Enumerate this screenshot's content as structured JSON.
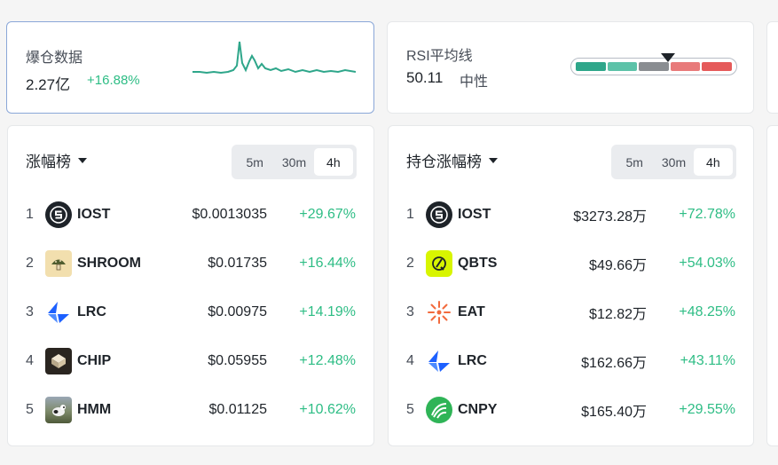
{
  "liquidation": {
    "title": "爆仓数据",
    "value": "2.27亿",
    "change": "+16.88%"
  },
  "rsi": {
    "title": "RSI平均线",
    "value": "50.11",
    "status": "中性",
    "segment_colors": [
      "#2ea68a",
      "#5cc2a8",
      "#8a8d91",
      "#e87a7a",
      "#e55a5a"
    ]
  },
  "gainers": {
    "title": "涨幅榜",
    "intervals": [
      "5m",
      "30m",
      "4h"
    ],
    "active_interval": "4h",
    "rows": [
      {
        "rank": "1",
        "icon": "iost-icon",
        "name": "IOST",
        "price": "$0.0013035",
        "change": "+29.67%"
      },
      {
        "rank": "2",
        "icon": "shroom-icon",
        "name": "SHROOM",
        "price": "$0.01735",
        "change": "+16.44%"
      },
      {
        "rank": "3",
        "icon": "lrc-icon",
        "name": "LRC",
        "price": "$0.00975",
        "change": "+14.19%"
      },
      {
        "rank": "4",
        "icon": "chip-icon",
        "name": "CHIP",
        "price": "$0.05955",
        "change": "+12.48%"
      },
      {
        "rank": "5",
        "icon": "hmm-icon",
        "name": "HMM",
        "price": "$0.01125",
        "change": "+10.62%"
      }
    ]
  },
  "oi_gainers": {
    "title": "持仓涨幅榜",
    "intervals": [
      "5m",
      "30m",
      "4h"
    ],
    "active_interval": "4h",
    "rows": [
      {
        "rank": "1",
        "icon": "iost-icon",
        "name": "IOST",
        "price": "$3273.28万",
        "change": "+72.78%"
      },
      {
        "rank": "2",
        "icon": "qbts-icon",
        "name": "QBTS",
        "price": "$49.66万",
        "change": "+54.03%"
      },
      {
        "rank": "3",
        "icon": "eat-icon",
        "name": "EAT",
        "price": "$12.82万",
        "change": "+48.25%"
      },
      {
        "rank": "4",
        "icon": "lrc-icon",
        "name": "LRC",
        "price": "$162.66万",
        "change": "+43.11%"
      },
      {
        "rank": "5",
        "icon": "cnpy-icon",
        "name": "CNPY",
        "price": "$165.40万",
        "change": "+29.55%"
      }
    ]
  },
  "colors": {
    "up": "#2ebd85",
    "sparkline": "#2ea68a",
    "active_border": "#8aa7d8"
  }
}
